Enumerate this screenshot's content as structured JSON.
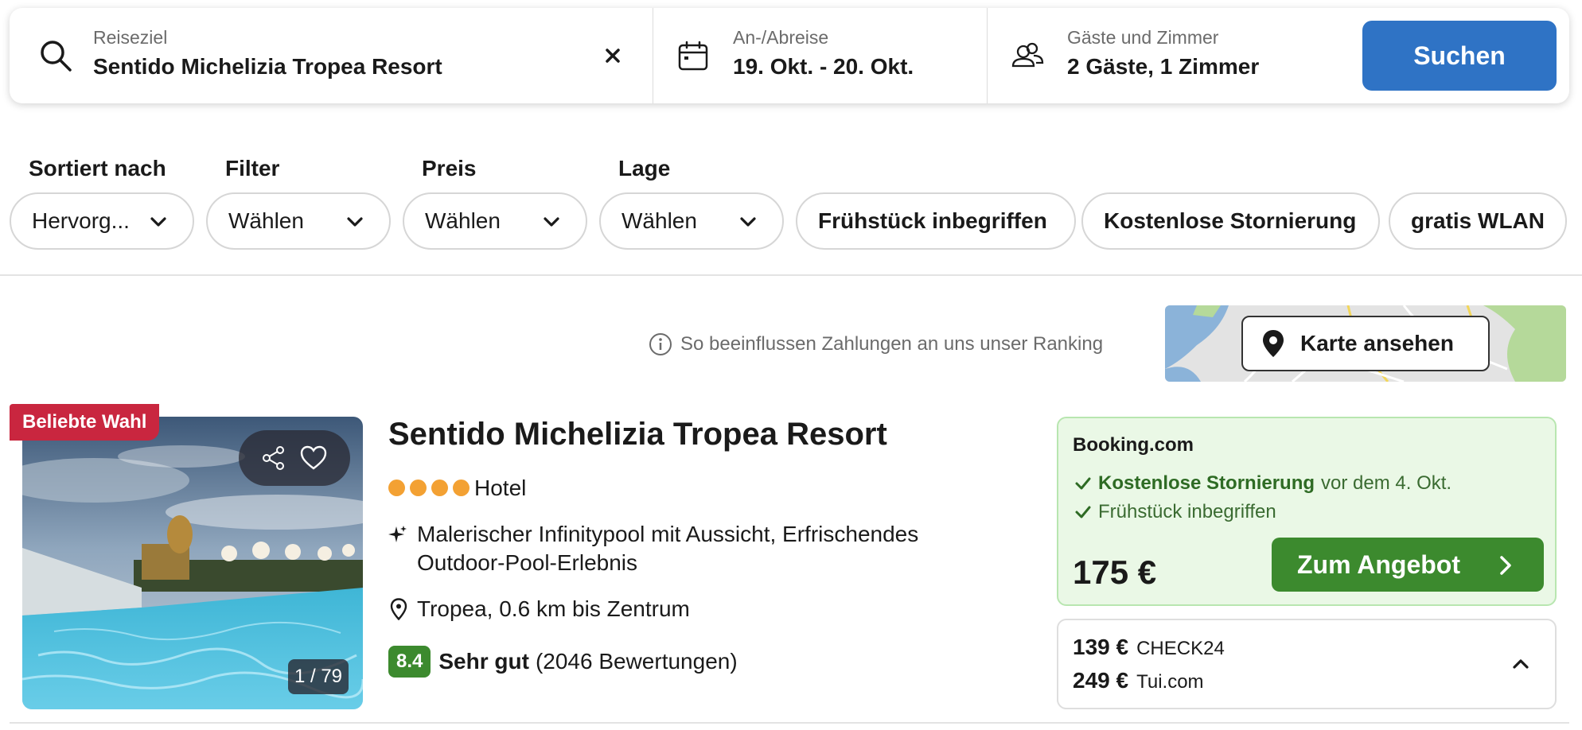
{
  "search": {
    "destination_label": "Reiseziel",
    "destination_value": "Sentido Michelizia Tropea Resort",
    "dates_label": "An-/Abreise",
    "dates_value": "19. Okt. - 20. Okt.",
    "guests_label": "Gäste und Zimmer",
    "guests_value": "2 Gäste, 1 Zimmer",
    "submit_label": "Suchen",
    "icons": [
      "search-icon",
      "close-icon",
      "calendar-icon",
      "guests-icon"
    ]
  },
  "filters": {
    "sort": {
      "title": "Sortiert nach",
      "value": "Hervorg..."
    },
    "filter": {
      "title": "Filter",
      "value": "Wählen"
    },
    "price": {
      "title": "Preis",
      "value": "Wählen"
    },
    "location": {
      "title": "Lage",
      "value": "Wählen"
    },
    "toggles": [
      "Frühstück inbegriffen",
      "Kostenlose Stornierung",
      "gratis WLAN"
    ]
  },
  "ranking_notice": "So beeinflussen Zahlungen an uns unser Ranking",
  "map": {
    "button_label": "Karte ansehen"
  },
  "hotel": {
    "badge": "Beliebte Wahl",
    "photo_counter": "1 / 79",
    "name": "Sentido Michelizia Tropea Resort",
    "stars": 4,
    "type": "Hotel",
    "highlights": "Malerischer Infinitypool mit Aussicht, Erfrischendes Outdoor-Pool-Erlebnis",
    "location": "Tropea, 0.6 km bis Zentrum",
    "rating_score": "8.4",
    "rating_text": "Sehr gut",
    "rating_count": "(2046 Bewertungen)"
  },
  "best_offer": {
    "provider": "Booking.com",
    "cancellation_bold": "Kostenlose Stornierung",
    "cancellation_rest": "vor dem 4. Okt.",
    "breakfast": "Frühstück inbegriffen",
    "price": "175 €",
    "cta_label": "Zum Angebot"
  },
  "other_offers": [
    {
      "price": "139 €",
      "provider": "CHECK24"
    },
    {
      "price": "249 €",
      "provider": "Tui.com"
    }
  ],
  "colors": {
    "primary_blue": "#2f73c5",
    "cta_green": "#3c8a2e",
    "offer_bg": "#eaf8e6",
    "badge_red": "#c9263f",
    "star_orange": "#f3a133"
  }
}
